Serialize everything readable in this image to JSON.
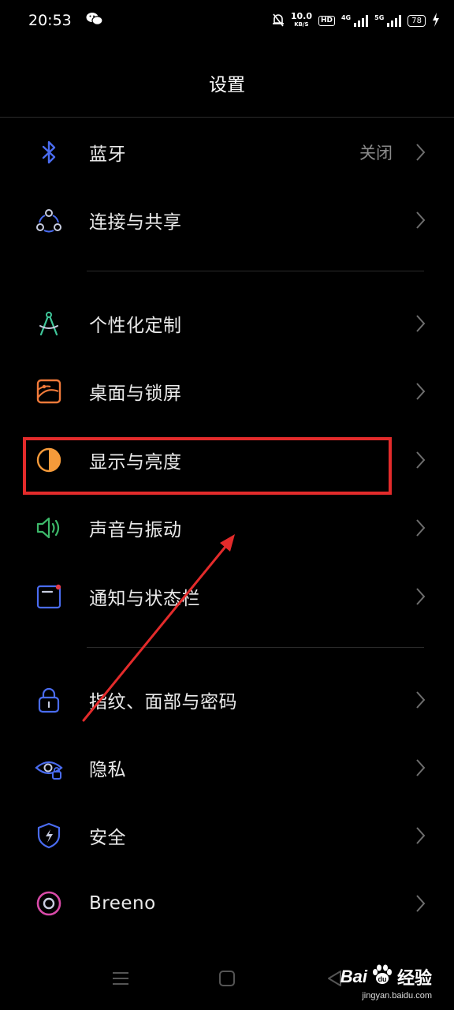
{
  "status_bar": {
    "time": "20:53",
    "app_icon": "wechat-icon",
    "mute_icon": "bell-off-icon",
    "net_speed": "10.0",
    "net_unit": "KB/S",
    "hd_label": "HD",
    "sim1_label": "4G",
    "sim2_label": "5G",
    "battery_level": "78",
    "charging_icon": "bolt-icon"
  },
  "header": {
    "title": "设置"
  },
  "settings": [
    {
      "label": "蓝牙",
      "value": "关闭",
      "icon": "bluetooth-icon"
    },
    {
      "label": "连接与共享",
      "icon": "connection-share-icon"
    },
    {
      "label": "个性化定制",
      "icon": "compass-icon"
    },
    {
      "label": "桌面与锁屏",
      "icon": "wallpaper-icon"
    },
    {
      "label": "显示与亮度",
      "icon": "brightness-icon"
    },
    {
      "label": "声音与振动",
      "icon": "speaker-icon"
    },
    {
      "label": "通知与状态栏",
      "icon": "notification-icon"
    },
    {
      "label": "指纹、面部与密码",
      "icon": "lock-icon"
    },
    {
      "label": "隐私",
      "icon": "privacy-eye-icon"
    },
    {
      "label": "安全",
      "icon": "shield-icon"
    },
    {
      "label": "Breeno",
      "icon": "breeno-icon"
    }
  ],
  "watermark": {
    "brand": "Bai",
    "brand_suffix": "经验",
    "site": "jingyan.baidu.com"
  },
  "colors": {
    "background": "#000000",
    "highlight_box": "#e32b2b",
    "arrow": "#e32b2b",
    "bluetooth": "#4a6cf0",
    "personalize": "#3fc79a",
    "wallpaper": "#f07a3a",
    "brightness": "#f59a3a",
    "sound": "#3db96a",
    "notification": "#4a6cf0",
    "breeno": "#d84aa8"
  }
}
